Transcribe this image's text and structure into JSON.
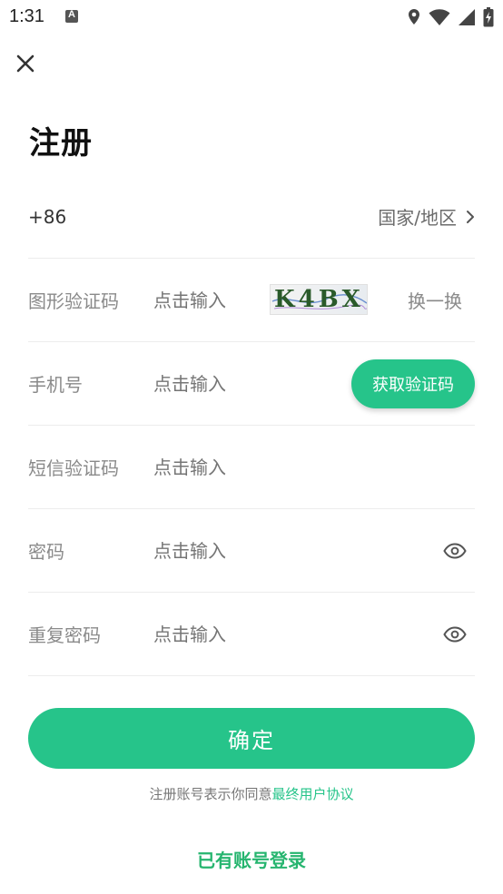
{
  "status_bar": {
    "time": "1:31"
  },
  "header": {
    "title": "注册"
  },
  "form": {
    "country": {
      "code": "+86",
      "region_label": "国家/地区"
    },
    "captcha": {
      "label": "图形验证码",
      "placeholder": "点击输入",
      "image_text": "K4BX",
      "refresh_label": "换一换"
    },
    "phone": {
      "label": "手机号",
      "placeholder": "点击输入",
      "send_code_label": "获取验证码"
    },
    "sms_code": {
      "label": "短信验证码",
      "placeholder": "点击输入"
    },
    "password": {
      "label": "密码",
      "placeholder": "点击输入"
    },
    "confirm_password": {
      "label": "重复密码",
      "placeholder": "点击输入"
    }
  },
  "actions": {
    "confirm_label": "确定",
    "agreement_prefix": "注册账号表示你同意",
    "agreement_link": "最终用户协议",
    "login_label": "已有账号登录"
  },
  "colors": {
    "accent": "#26c48a",
    "login_text": "#26b56f"
  }
}
